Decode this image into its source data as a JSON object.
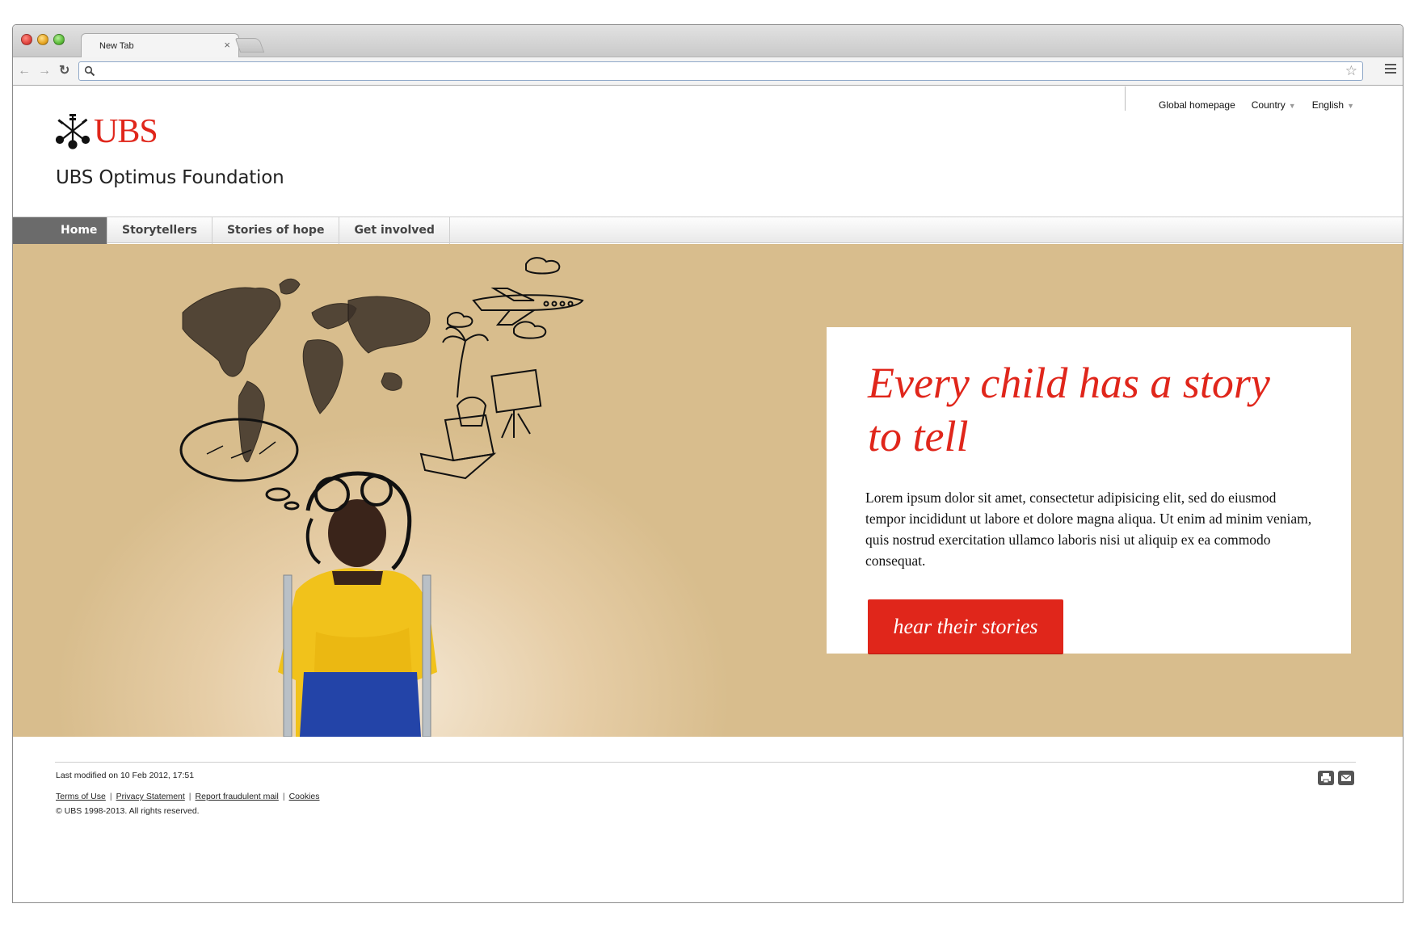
{
  "browser": {
    "tab_title": "New Tab",
    "tab_close": "×",
    "address_value": "",
    "back_icon": "arrow-left-icon",
    "forward_icon": "arrow-right-icon",
    "reload_icon": "reload-icon",
    "star_icon": "star-icon"
  },
  "utility_nav": {
    "global_homepage": "Global homepage",
    "country": "Country",
    "language": "English"
  },
  "brand": {
    "logo_text": "UBS",
    "foundation_name": "UBS Optimus Foundation",
    "accent_color": "#e0261b"
  },
  "main_nav": {
    "items": [
      {
        "label": "Home",
        "active": true
      },
      {
        "label": "Storytellers",
        "active": false
      },
      {
        "label": "Stories of hope",
        "active": false
      },
      {
        "label": "Get involved",
        "active": false
      }
    ]
  },
  "hero": {
    "title": "Every child has a story to tell",
    "body": "Lorem ipsum dolor sit amet, consectetur adipisicing elit, sed do eiusmod tempor incididunt ut labore et dolore magna aliqua. Ut enim ad minim veniam, quis nostrud exercitation ullamco laboris nisi ut aliquip ex ea commodo consequat.",
    "cta_label": "hear their stories",
    "background_color": "#d8bd8d"
  },
  "footer": {
    "last_modified": "Last modified on 10 Feb 2012, 17:51",
    "links": [
      "Terms of Use",
      "Privacy Statement",
      "Report fraudulent mail",
      "Cookies"
    ],
    "copyright": "© UBS 1998-2013. All rights reserved.",
    "print_icon": "print-icon",
    "email_icon": "email-icon"
  }
}
